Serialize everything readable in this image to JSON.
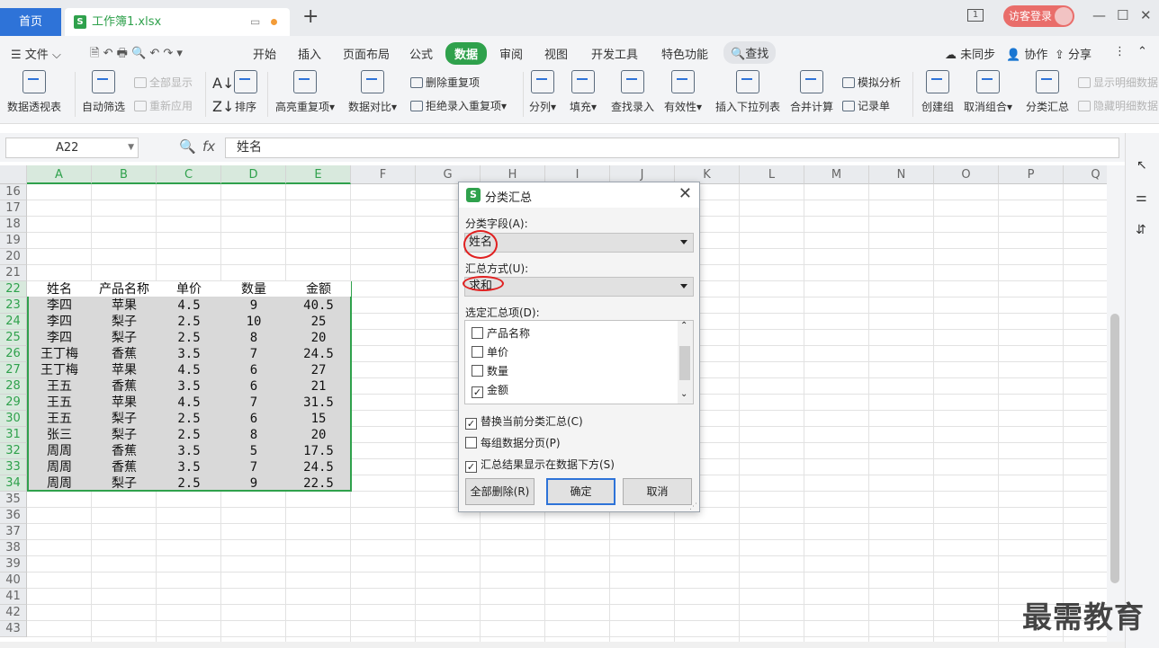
{
  "titlebar": {
    "home_tab": "首页",
    "file_tab": "工作簿1.xlsx",
    "login": "访客登录",
    "page_indicator": "1"
  },
  "menu": {
    "file": "文件",
    "items": [
      "开始",
      "插入",
      "页面布局",
      "公式",
      "数据",
      "审阅",
      "视图",
      "开发工具",
      "特色功能"
    ],
    "active": "数据",
    "search": "查找",
    "sync": "未同步",
    "collab": "协作",
    "share": "分享"
  },
  "ribbon": {
    "pivot": "数据透视表",
    "autofilter": "自动筛选",
    "show_all": "全部显示",
    "reapply": "重新应用",
    "sort": "排序",
    "highlight_dup": "高亮重复项",
    "compare": "数据对比",
    "remove_dup": "删除重复项",
    "reject_dup": "拒绝录入重复项",
    "split": "分列",
    "fill": "填充",
    "lookup_entry": "查找录入",
    "validity": "有效性",
    "insert_dropdown": "插入下拉列表",
    "consolidate": "合并计算",
    "whatif": "模拟分析",
    "record_sheet": "记录单",
    "group": "创建组",
    "ungroup": "取消组合",
    "subtotal": "分类汇总",
    "show_detail": "显示明细数据",
    "hide_detail": "隐藏明细数据"
  },
  "formula_bar": {
    "cell_ref": "A22",
    "fx": "fx",
    "content": "姓名"
  },
  "sheet": {
    "columns": [
      "A",
      "B",
      "C",
      "D",
      "E",
      "F",
      "G",
      "H",
      "I",
      "J",
      "K",
      "L",
      "M",
      "N",
      "O",
      "P",
      "Q"
    ],
    "rows": [
      "16",
      "17",
      "18",
      "19",
      "20",
      "21",
      "22",
      "23",
      "24",
      "25",
      "26",
      "27",
      "28",
      "29",
      "30",
      "31",
      "32",
      "33",
      "34",
      "35",
      "36",
      "37",
      "38",
      "39",
      "40",
      "41",
      "42",
      "43"
    ],
    "headers": [
      "姓名",
      "产品名称",
      "单价",
      "数量",
      "金额"
    ],
    "data": [
      [
        "李四",
        "苹果",
        "4.5",
        "9",
        "40.5"
      ],
      [
        "李四",
        "梨子",
        "2.5",
        "10",
        "25"
      ],
      [
        "李四",
        "梨子",
        "2.5",
        "8",
        "20"
      ],
      [
        "王丁梅",
        "香蕉",
        "3.5",
        "7",
        "24.5"
      ],
      [
        "王丁梅",
        "苹果",
        "4.5",
        "6",
        "27"
      ],
      [
        "王五",
        "香蕉",
        "3.5",
        "6",
        "21"
      ],
      [
        "王五",
        "苹果",
        "4.5",
        "7",
        "31.5"
      ],
      [
        "王五",
        "梨子",
        "2.5",
        "6",
        "15"
      ],
      [
        "张三",
        "梨子",
        "2.5",
        "8",
        "20"
      ],
      [
        "周周",
        "香蕉",
        "3.5",
        "5",
        "17.5"
      ],
      [
        "周周",
        "香蕉",
        "3.5",
        "7",
        "24.5"
      ],
      [
        "周周",
        "梨子",
        "2.5",
        "9",
        "22.5"
      ]
    ]
  },
  "dialog": {
    "title": "分类汇总",
    "field_label": "分类字段(A):",
    "field_value": "姓名",
    "method_label": "汇总方式(U):",
    "method_value": "求和",
    "items_label": "选定汇总项(D):",
    "items": [
      {
        "label": "产品名称",
        "checked": false
      },
      {
        "label": "单价",
        "checked": false
      },
      {
        "label": "数量",
        "checked": false
      },
      {
        "label": "金额",
        "checked": true
      }
    ],
    "opt_replace": "替换当前分类汇总(C)",
    "opt_pagebreak": "每组数据分页(P)",
    "opt_below": "汇总结果显示在数据下方(S)",
    "btn_remove_all": "全部删除(R)",
    "btn_ok": "确定",
    "btn_cancel": "取消"
  },
  "watermark": "最需教育"
}
